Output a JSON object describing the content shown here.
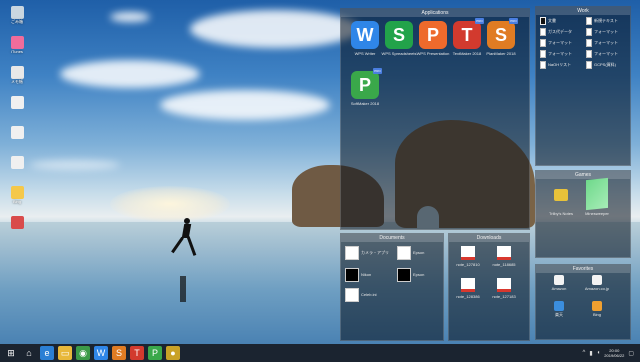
{
  "desktop": {
    "icons": [
      {
        "label": "ごみ箱",
        "icon": "recycle-bin-icon",
        "color": "#c9d6e0"
      },
      {
        "label": "iTunes",
        "icon": "itunes-icon",
        "color": "#f06c9b"
      },
      {
        "label": "メモ帳",
        "icon": "notepad-icon",
        "color": "#e8e8e8"
      },
      {
        "label": "",
        "icon": "document-icon",
        "color": "#f0f0f0"
      },
      {
        "label": "",
        "icon": "document-icon",
        "color": "#f0f0f0"
      },
      {
        "label": "",
        "icon": "document-icon",
        "color": "#f0f0f0"
      },
      {
        "label": "Bing",
        "icon": "folder-icon",
        "color": "#f5c84a"
      },
      {
        "label": "",
        "icon": "shortcut-icon",
        "color": "#d94b4b"
      }
    ]
  },
  "fences": {
    "applications": {
      "title": "Applications",
      "apps": [
        {
          "letter": "W",
          "label": "WPS Writer",
          "color": "#2f86e8",
          "badge": ""
        },
        {
          "letter": "S",
          "label": "WPS Spreadsheets",
          "color": "#22a34a",
          "badge": ""
        },
        {
          "letter": "P",
          "label": "WPS Presentation",
          "color": "#ee6a2c",
          "badge": ""
        },
        {
          "letter": "T",
          "label": "TextMaker 2018",
          "color": "#d23a2e",
          "badge": "PRO"
        },
        {
          "letter": "S",
          "label": "PlanMaker 2018",
          "color": "#e07c23",
          "badge": "PRO"
        },
        {
          "letter": "P",
          "label": "SoftMaker 2018",
          "color": "#3aa84a",
          "badge": "PRO"
        }
      ]
    },
    "work": {
      "title": "Work",
      "items": [
        {
          "label": "文書"
        },
        {
          "label": "新規テキスト"
        },
        {
          "label": "ガス代データ"
        },
        {
          "label": "フォーマット"
        },
        {
          "label": "フォーマット"
        },
        {
          "label": "フォーマット"
        },
        {
          "label": "フォーマット"
        },
        {
          "label": "フォーマット"
        },
        {
          "label": "NaOHリスト"
        },
        {
          "label": "GCPS(資料)"
        }
      ]
    },
    "games": {
      "title": "Games",
      "items": [
        {
          "label": "Trilby's Notes",
          "icon": "game-icon"
        },
        {
          "label": "Minesweeper",
          "icon": "game-icon"
        }
      ]
    },
    "documents": {
      "title": "Documents",
      "items": [
        {
          "label": "カメラ・アプリ",
          "icon": "calculator-icon"
        },
        {
          "label": "Epson",
          "icon": "calculator-icon"
        },
        {
          "label": "Nikon",
          "icon": "app-icon"
        },
        {
          "label": "Epson",
          "icon": "app-icon"
        },
        {
          "label": "Celeb.ini",
          "icon": "calculator-icon"
        }
      ]
    },
    "downloads": {
      "title": "Downloads",
      "items": [
        {
          "label": "note_127810"
        },
        {
          "label": "note_118685"
        },
        {
          "label": "note_128386"
        },
        {
          "label": "note_127183"
        }
      ]
    },
    "favorites": {
      "title": "Favorites",
      "items": [
        {
          "label": "Amazon",
          "icon": "amazon-icon"
        },
        {
          "label": "Amazon.co.jp",
          "icon": "amazon-icon"
        },
        {
          "label": "楽天",
          "icon": "globe-icon"
        },
        {
          "label": "Bing",
          "icon": "bing-icon"
        }
      ]
    }
  },
  "taskbar": {
    "buttons": [
      {
        "icon": "start-icon",
        "glyph": "⊞",
        "color": "#1b2430"
      },
      {
        "icon": "home-icon",
        "glyph": "⌂",
        "color": "#1b2430"
      },
      {
        "icon": "edge-icon",
        "glyph": "e",
        "color": "#2b7fd4"
      },
      {
        "icon": "folder-icon",
        "glyph": "▭",
        "color": "#e8b83a"
      },
      {
        "icon": "chrome-icon",
        "glyph": "◉",
        "color": "#3c9a47"
      },
      {
        "icon": "wps-writer-icon",
        "glyph": "W",
        "color": "#2f86e8"
      },
      {
        "icon": "softmaker-icon",
        "glyph": "S",
        "color": "#e07c23"
      },
      {
        "icon": "textmaker-icon",
        "glyph": "T",
        "color": "#d23a2e"
      },
      {
        "icon": "presentation-icon",
        "glyph": "P",
        "color": "#3aa84a"
      },
      {
        "icon": "app-icon",
        "glyph": "●",
        "color": "#c9a227"
      }
    ],
    "tray": {
      "chevron": "^",
      "time": "20:00",
      "date": "2019/06/22"
    }
  }
}
